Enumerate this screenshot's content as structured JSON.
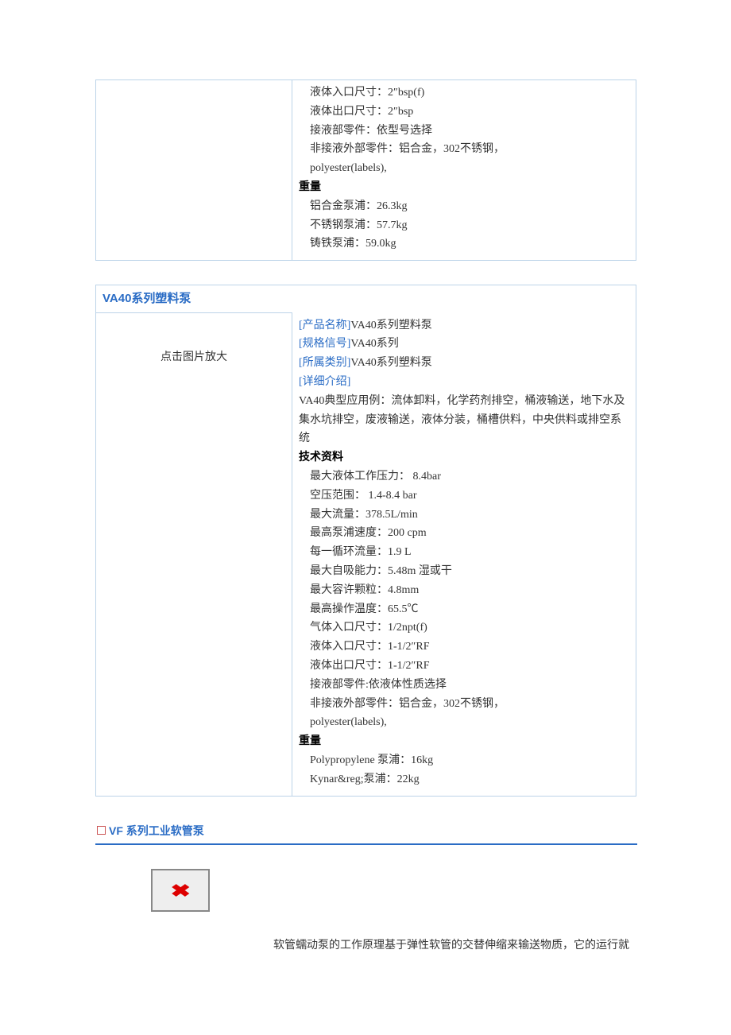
{
  "table1": {
    "specs": [
      "液体入口尺寸：2″bsp(f)",
      "液体出口尺寸：2″bsp",
      "接液部零件：依型号选择",
      "非接液外部零件：铝合金，302不锈钢，",
      "polyester(labels),"
    ],
    "weight_heading": "重量",
    "weights": [
      "铝合金泵浦：26.3kg",
      "不锈钢泵浦：57.7kg",
      "铸铁泵浦：59.0kg"
    ]
  },
  "table2": {
    "title": "VA40系列塑料泵",
    "zoom_text": "点击图片放大",
    "labels": {
      "name": "[产品名称]",
      "spec": "[规格信号]",
      "cat": "[所属类别]",
      "detail": "[详细介绍]"
    },
    "values": {
      "name": "VA40系列塑料泵",
      "spec": "VA40系列",
      "cat": "VA40系列塑料泵"
    },
    "desc": "VA40典型应用例：流体卸料，化学药剂排空，桶液输送，地下水及集水坑排空，废液输送，液体分装，桶槽供料，中央供料或排空系统",
    "tech_heading": "技术资料",
    "tech": [
      "最大液体工作压力： 8.4bar",
      "空压范围： 1.4-8.4 bar",
      "最大流量：378.5L/min",
      "最高泵浦速度：200 cpm",
      "每一循环流量：1.9 L",
      "最大自吸能力：5.48m 湿或干",
      "最大容许颗粒：4.8mm",
      "最高操作温度：65.5℃",
      "气体入口尺寸：1/2npt(f)",
      "液体入口尺寸：1-1/2″RF",
      "液体出口尺寸：1-1/2″RF",
      "接液部零件:依液体性质选择",
      "非接液外部零件：铝合金，302不锈钢，",
      "polyester(labels),"
    ],
    "weight_heading": "重量",
    "weights": [
      "Polypropylene 泵浦：16kg",
      "Kynar&reg;泵浦：22kg"
    ]
  },
  "section3": {
    "title": "VF 系列工业软管泵",
    "para": "软管蠕动泵的工作原理基于弹性软管的交替伸缩来输送物质，它的运行就"
  }
}
